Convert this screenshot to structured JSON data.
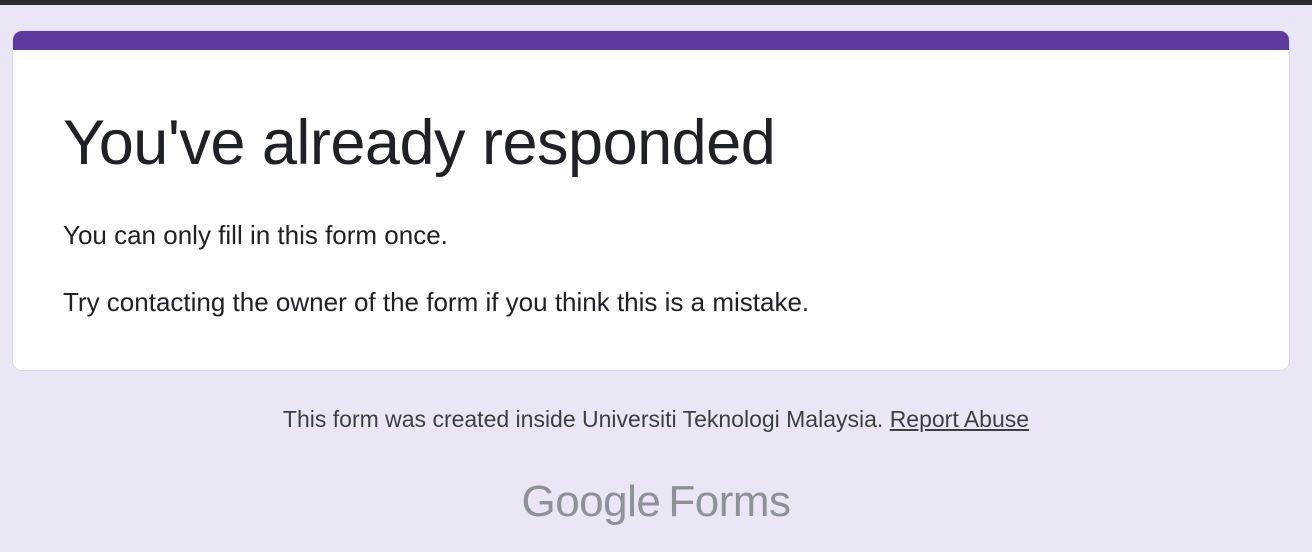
{
  "card": {
    "title": "You've already responded",
    "line1": "You can only fill in this form once.",
    "line2": "Try contacting the owner of the form if you think this is a mistake."
  },
  "footer": {
    "notice": "This form was created inside Universiti Teknologi Malaysia. ",
    "report_link": "Report Abuse"
  },
  "brand": {
    "google": "Google",
    "forms": "Forms"
  },
  "colors": {
    "page_background": "#ebe6f5",
    "accent": "#5c3a9e",
    "card_background": "#ffffff",
    "text_primary": "#202124",
    "text_secondary": "#3c4043",
    "brand_gray": "#8e9197"
  }
}
